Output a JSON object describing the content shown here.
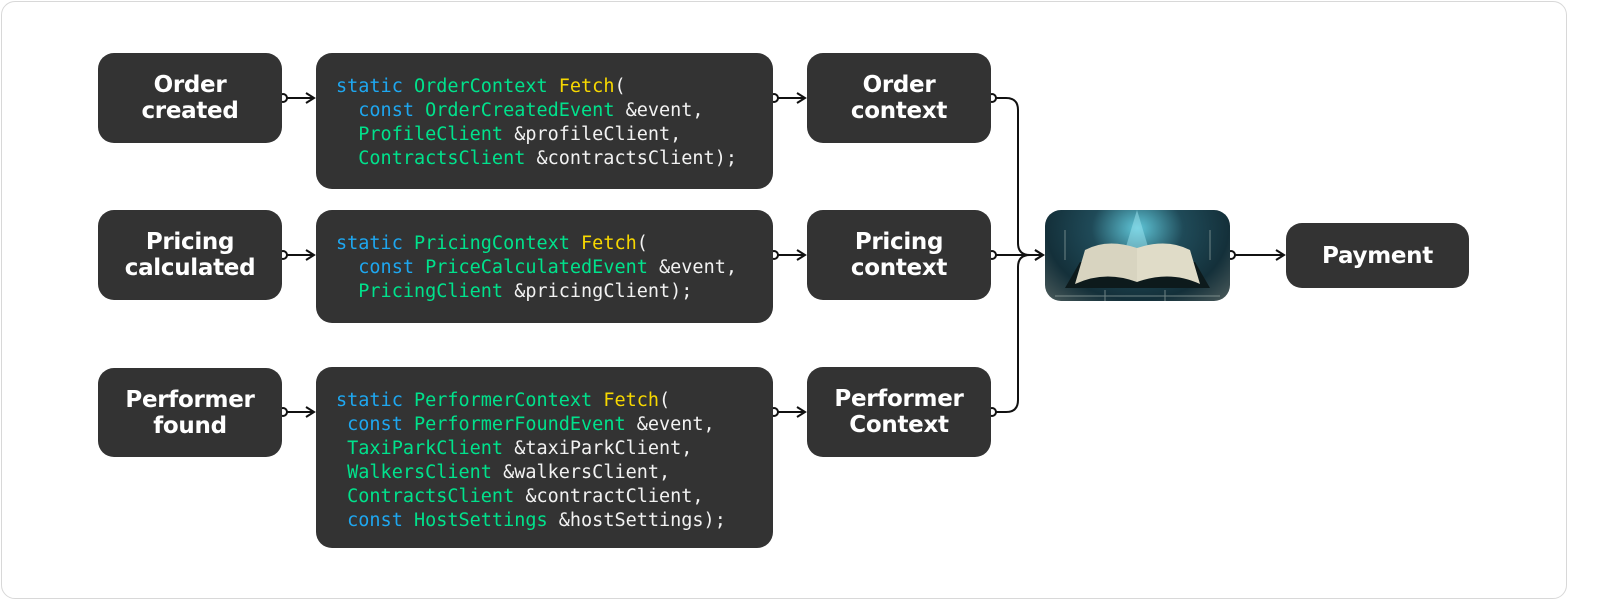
{
  "events": [
    {
      "label": "Order\ncreated"
    },
    {
      "label": "Pricing\ncalculated"
    },
    {
      "label": "Performer\nfound"
    }
  ],
  "code_blocks": [
    {
      "lines": [
        [
          {
            "t": "static ",
            "c": "kw"
          },
          {
            "t": "OrderContext ",
            "c": "ty"
          },
          {
            "t": "Fetch",
            "c": "fn"
          },
          {
            "t": "(",
            "c": "tx"
          }
        ],
        [
          {
            "t": "  const ",
            "c": "kw"
          },
          {
            "t": "OrderCreatedEvent ",
            "c": "ty"
          },
          {
            "t": "&event,",
            "c": "tx"
          }
        ],
        [
          {
            "t": "  ProfileClient ",
            "c": "ty"
          },
          {
            "t": "&profileClient,",
            "c": "tx"
          }
        ],
        [
          {
            "t": "  ContractsClient ",
            "c": "ty"
          },
          {
            "t": "&contractsClient);",
            "c": "tx"
          }
        ]
      ]
    },
    {
      "lines": [
        [
          {
            "t": "static ",
            "c": "kw"
          },
          {
            "t": "PricingContext ",
            "c": "ty"
          },
          {
            "t": "Fetch",
            "c": "fn"
          },
          {
            "t": "(",
            "c": "tx"
          }
        ],
        [
          {
            "t": "  const ",
            "c": "kw"
          },
          {
            "t": "PriceCalculatedEvent ",
            "c": "ty"
          },
          {
            "t": "&event,",
            "c": "tx"
          }
        ],
        [
          {
            "t": "  PricingClient ",
            "c": "ty"
          },
          {
            "t": "&pricingClient);",
            "c": "tx"
          }
        ]
      ]
    },
    {
      "lines": [
        [
          {
            "t": "static ",
            "c": "kw"
          },
          {
            "t": "PerformerContext ",
            "c": "ty"
          },
          {
            "t": "Fetch",
            "c": "fn"
          },
          {
            "t": "(",
            "c": "tx"
          }
        ],
        [
          {
            "t": " const ",
            "c": "kw"
          },
          {
            "t": "PerformerFoundEvent ",
            "c": "ty"
          },
          {
            "t": "&event,",
            "c": "tx"
          }
        ],
        [
          {
            "t": " TaxiParkClient ",
            "c": "ty"
          },
          {
            "t": "&taxiParkClient,",
            "c": "tx"
          }
        ],
        [
          {
            "t": " WalkersClient ",
            "c": "ty"
          },
          {
            "t": "&walkersClient,",
            "c": "tx"
          }
        ],
        [
          {
            "t": " ContractsClient ",
            "c": "ty"
          },
          {
            "t": "&contractClient,",
            "c": "tx"
          }
        ],
        [
          {
            "t": " const ",
            "c": "kw"
          },
          {
            "t": "HostSettings ",
            "c": "ty"
          },
          {
            "t": "&hostSettings);",
            "c": "tx"
          }
        ]
      ]
    }
  ],
  "contexts": [
    {
      "label": "Order\ncontext"
    },
    {
      "label": "Pricing\ncontext"
    },
    {
      "label": "Performer\nContext"
    }
  ],
  "aggregator": {
    "icon": "open-book-image"
  },
  "payment": {
    "label": "Payment"
  },
  "colors": {
    "box": "#333333",
    "keyword": "#1ea7f0",
    "type": "#00e28c",
    "function": "#f7d800",
    "text": "#f2f2f2"
  }
}
